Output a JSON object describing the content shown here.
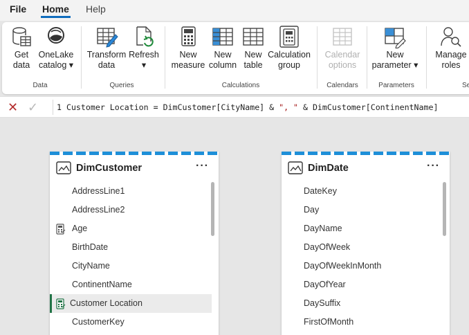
{
  "menu": {
    "file": "File",
    "home": "Home",
    "help": "Help"
  },
  "ribbon": {
    "buttons": {
      "get_data": [
        "Get",
        "data"
      ],
      "onelake": [
        "OneLake",
        "catalog ▾"
      ],
      "transform": [
        "Transform",
        "data"
      ],
      "refresh": [
        "Refresh",
        "▾"
      ],
      "new_measure": [
        "New",
        "measure"
      ],
      "new_column": [
        "New",
        "column"
      ],
      "new_table": [
        "New",
        "table"
      ],
      "calc_group": [
        "Calculation",
        "group"
      ],
      "calendar_options": [
        "Calendar",
        "options"
      ],
      "new_parameter": [
        "New",
        "parameter ▾"
      ],
      "manage_roles": [
        "Manage",
        "roles"
      ]
    },
    "groups": {
      "data": "Data",
      "queries": "Queries",
      "calculations": "Calculations",
      "calendars": "Calendars",
      "parameters": "Parameters",
      "security": "Se"
    }
  },
  "formula_bar": {
    "line_number": "1",
    "text_before": "Customer Location = DimCustomer[CityName] & ",
    "string1": "\", \"",
    "text_middle": " & DimCustomer[ContinentName]"
  },
  "tables": {
    "customer": {
      "name": "DimCustomer",
      "fields": [
        "AddressLine1",
        "AddressLine2",
        "Age",
        "BirthDate",
        "CityName",
        "ContinentName",
        "Customer Location",
        "CustomerKey"
      ]
    },
    "date": {
      "name": "DimDate",
      "fields": [
        "DateKey",
        "Day",
        "DayName",
        "DayOfWeek",
        "DayOfWeekInMonth",
        "DayOfYear",
        "DaySuffix",
        "FirstOfMonth"
      ]
    }
  },
  "colors": {
    "accent": "#0f6cbd",
    "stripe": "#1e8fd8",
    "selection_bar": "#217346",
    "error_x": "#b42d2d"
  }
}
